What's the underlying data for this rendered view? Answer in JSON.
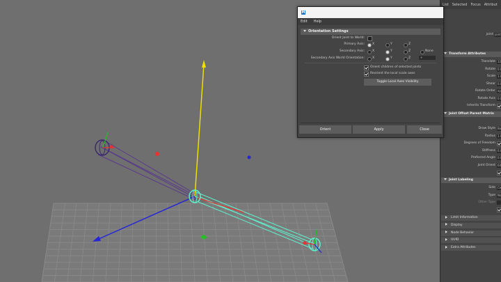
{
  "viewport": {
    "colors": {
      "bg": "#6f6f6f",
      "grid": "#8a8a8a",
      "bone": "#5ef0cc",
      "y_axis": "#f0e000",
      "x_axis": "#2424d8",
      "z_axis": "#e83232"
    }
  },
  "dialog": {
    "menu": [
      "Edit",
      "Help"
    ],
    "section_title": "Orientation Settings",
    "orient_to_world": "Orient Joint to World:",
    "primary_axis": {
      "label": "Primary Axis:",
      "options": [
        "X",
        "Y",
        "Z"
      ],
      "selected": 0
    },
    "secondary_axis": {
      "label": "Secondary Axis:",
      "options": [
        "X",
        "Y",
        "Z",
        "None"
      ],
      "selected": 1
    },
    "secondary_world": {
      "label": "Secondary Axis World Orientation:",
      "options": [
        "X",
        "Y",
        "Z"
      ],
      "selected": 1,
      "dropdown": "+"
    },
    "orient_children": "Orient children of selected joints",
    "reorient_scale": "Reorient the local scale axes",
    "toggle_button": "Toggle Local Axes Visibility",
    "buttons": {
      "orient": "Orient",
      "apply": "Apply",
      "close": "Close"
    }
  },
  "attr_editor": {
    "menu": [
      "List",
      "Selected",
      "Focus",
      "Attribut"
    ],
    "joint_name_label": "joint:",
    "joint_name_value": "joint",
    "transform_header": "Transform Attributes",
    "transform_rows": [
      {
        "label": "Translate",
        "value": "12."
      },
      {
        "label": "Rotate",
        "value": "0.0"
      },
      {
        "label": "Scale",
        "value": "1.0"
      },
      {
        "label": "Shear",
        "value": "0.0"
      },
      {
        "label": "Rotate Order",
        "value": "xyz"
      },
      {
        "label": "Rotate Axis",
        "value": "0.0"
      },
      {
        "label": "Inherits Transform",
        "value": ""
      }
    ],
    "offset_header": "Joint Offset Parent Matrix",
    "joint_rows": [
      {
        "label": "Draw Style",
        "value": "Bo"
      },
      {
        "label": "Radius",
        "value": "1.0"
      },
      {
        "label": "Degrees of Freedom",
        "value": ""
      },
      {
        "label": "Stiffness",
        "value": "0.0"
      },
      {
        "label": "Preferred Angle",
        "value": "0.0"
      },
      {
        "label": "Joint Orient",
        "value": "64"
      },
      {
        "label": "",
        "value": ""
      }
    ],
    "labeling_header": "Joint Labeling",
    "labeling_rows": [
      {
        "label": "Side",
        "value": "Ce"
      },
      {
        "label": "Type",
        "value": "No"
      },
      {
        "label": "Other Type",
        "value": ""
      }
    ],
    "sections": [
      "Limit Information",
      "Display",
      "Node Behavior",
      "UUID",
      "Extra Attributes"
    ]
  }
}
